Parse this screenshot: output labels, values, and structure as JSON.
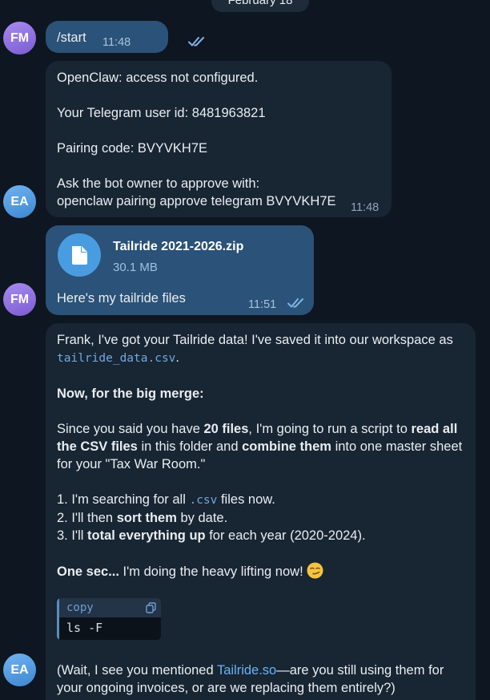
{
  "date_separator": "February 18",
  "colors": {
    "background": "#0e1621",
    "outgoing_bubble": "#2b5278",
    "incoming_bubble": "#182533",
    "link": "#6ab4f3"
  },
  "messages": [
    {
      "id": "m1",
      "sender_initials": "FM",
      "direction": "outgoing",
      "text": "/start",
      "time": "11:48",
      "status": "read"
    },
    {
      "id": "m2",
      "sender_initials": "EA",
      "direction": "incoming",
      "lines": [
        "OpenClaw: access not configured.",
        "Your Telegram user id: 8481963821",
        "Pairing code: BVYVKH7E",
        "Ask the bot owner to approve with:",
        "openclaw pairing approve telegram BVYVKH7E"
      ],
      "time": "11:48"
    },
    {
      "id": "m3",
      "sender_initials": "FM",
      "direction": "outgoing",
      "file": {
        "name": "Tailride 2021-2026.zip",
        "size": "30.1 MB",
        "icon": "file-icon"
      },
      "caption": "Here's my tailride files",
      "time": "11:51",
      "status": "read"
    },
    {
      "id": "m4",
      "sender_initials": "EA",
      "direction": "incoming",
      "intro": "Frank, I've got your Tailride data! I've saved it into our workspace as",
      "filename": "tailride_data.csv",
      "intro_end": ".",
      "heading": "Now, for the big merge:",
      "para": {
        "t1": "Since you said you have ",
        "b1": "20 files",
        "t2": ", I'm going to run a script to ",
        "b2": "read all the CSV files",
        "t3": " in this folder and ",
        "b3": "combine them",
        "t4": " into one master sheet for your \"Tax War Room.\""
      },
      "steps": {
        "s1_a": "1. I'm searching for all ",
        "s1_code": ".csv",
        "s1_b": " files now.",
        "s2_a": "2. I'll then ",
        "s2_bold": "sort them",
        "s2_b": " by date.",
        "s3_a": "3. I'll ",
        "s3_bold": "total everything up",
        "s3_b": " for each year (2020-2024)."
      },
      "one_sec_bold": "One sec...",
      "one_sec_rest": " I'm doing the heavy lifting now! ",
      "emoji": "smirk",
      "code_block": {
        "header": "copy",
        "code": "ls -F"
      },
      "tail": {
        "t1": "(Wait, I see you mentioned ",
        "link": "Tailride.so",
        "t2": "—are you still using them for your ongoing invoices, or are we replacing them entirely?)"
      }
    }
  ]
}
